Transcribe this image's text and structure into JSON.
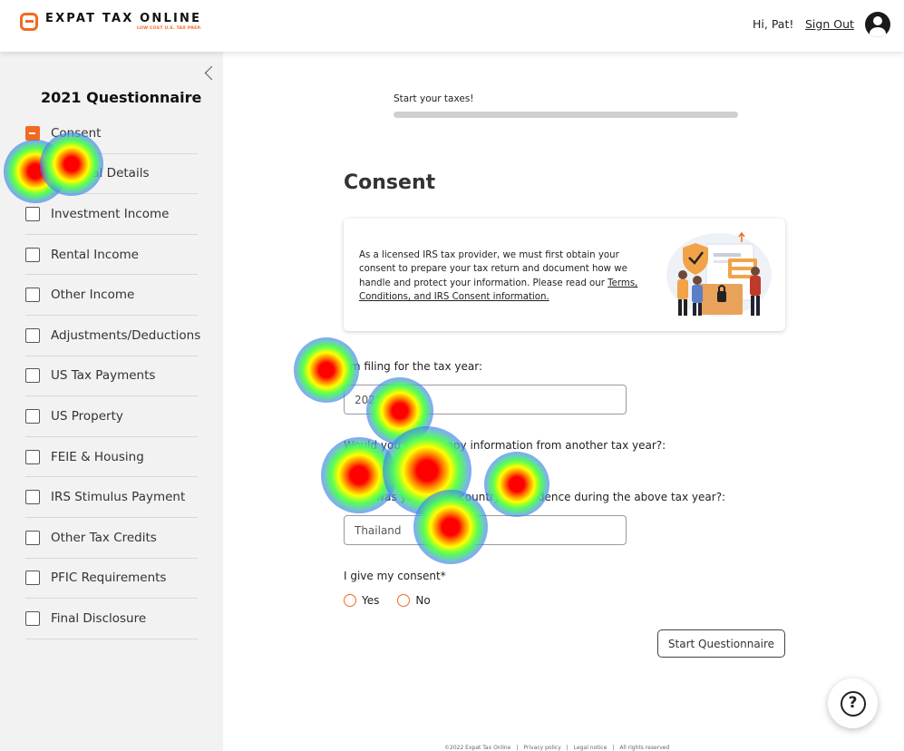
{
  "header": {
    "logo_name": "EXPAT TAX ONLINE",
    "logo_tagline": "LOW COST U.S. TAX PREP.",
    "greeting": "Hi, Pat!",
    "signout_label": "Sign Out",
    "brand_color": "#f26a21"
  },
  "sidebar": {
    "title": "2021 Questionnaire",
    "items": [
      {
        "label": "Consent",
        "active": true
      },
      {
        "label": "Personal Details"
      },
      {
        "label": "Investment Income"
      },
      {
        "label": "Rental Income"
      },
      {
        "label": "Other Income"
      },
      {
        "label": "Adjustments/Deductions"
      },
      {
        "label": "US Tax Payments"
      },
      {
        "label": "US Property"
      },
      {
        "label": "FEIE & Housing"
      },
      {
        "label": "IRS Stimulus Payment"
      },
      {
        "label": "Other Tax Credits"
      },
      {
        "label": "PFIC Requirements"
      },
      {
        "label": "Final Disclosure"
      }
    ]
  },
  "main": {
    "progress_label": "Start your taxes!",
    "progress_fraction": 0,
    "page_title": "Consent",
    "consent_text": "As a licensed IRS tax provider, we must first obtain your consent to prepare your tax return and document how we handle and protect your information. Please read our ",
    "consent_link": "Terms, Conditions, and IRS Consent information.",
    "tax_year_label": "I'm filing for the tax year:",
    "tax_year_value": "2021",
    "copy_label": "Would you like to copy information from another tax year?:",
    "country_label": "What was your main country of residence during the above tax year?:",
    "country_value": "Thailand",
    "consent_question": "I give my consent*",
    "radio_yes": "Yes",
    "radio_no": "No",
    "start_button": "Start Questionnaire"
  },
  "footer": {
    "copyright": "©2022 Expat Tax Online",
    "privacy": "Privacy policy",
    "legal": "Legal notice",
    "rights": "All rights reserved"
  },
  "icons": {
    "logo": "logo-icon",
    "user": "user-account-icon",
    "collapse": "chevron-left-icon",
    "help": "help-question-icon"
  }
}
